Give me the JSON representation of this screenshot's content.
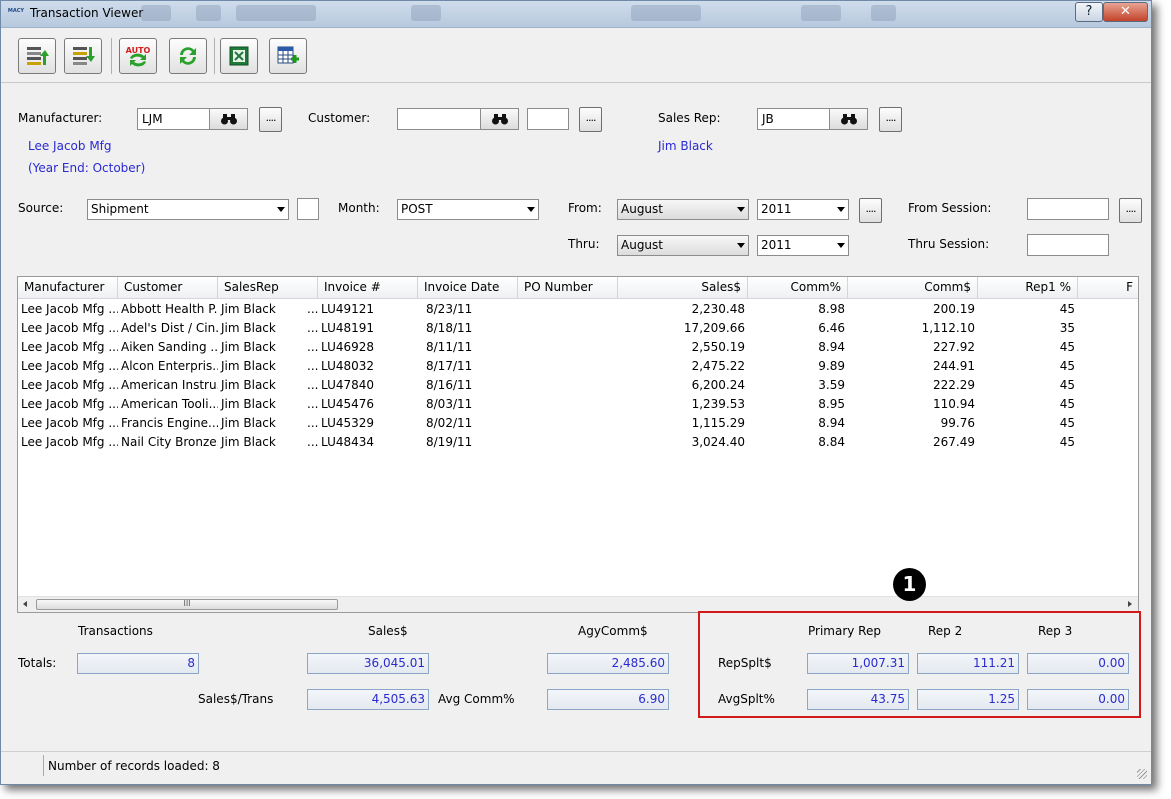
{
  "window": {
    "title": "Transaction Viewer",
    "help_label": "?",
    "close_label": "✕",
    "app_icon_text": "MACY"
  },
  "toolbar": {
    "buttons": [
      {
        "name": "import-up-button",
        "icon": "stack-up-arrow-icon"
      },
      {
        "name": "import-down-button",
        "icon": "stack-down-arrow-icon"
      },
      {
        "name": "auto-refresh-button",
        "icon": "auto-refresh-icon",
        "text": "AUTO"
      },
      {
        "name": "refresh-button",
        "icon": "refresh-icon"
      },
      {
        "name": "excel-export-button",
        "icon": "excel-icon"
      },
      {
        "name": "add-grid-button",
        "icon": "grid-add-icon"
      }
    ]
  },
  "filters": {
    "manufacturer_label": "Manufacturer:",
    "manufacturer_value": "LJM",
    "manufacturer_name": "Lee Jacob Mfg",
    "manufacturer_yearend": "(Year End: October)",
    "customer_label": "Customer:",
    "customer_value": "",
    "customer_value2": "",
    "salesrep_label": "Sales Rep:",
    "salesrep_value": "JB",
    "salesrep_name": "Jim Black",
    "source_label": "Source:",
    "source_value": "Shipment",
    "month_label": "Month:",
    "month_value": "POST",
    "from_label": "From:",
    "from_month": "August",
    "from_year": "2011",
    "thru_label": "Thru:",
    "thru_month": "August",
    "thru_year": "2011",
    "from_session_label": "From Session:",
    "from_session_value": "",
    "thru_session_label": "Thru Session:",
    "thru_session_value": "",
    "ellipsis": "...."
  },
  "grid": {
    "columns": [
      "Manufacturer",
      "Customer",
      "SalesRep",
      "Invoice #",
      "Invoice Date",
      "PO Number",
      "Sales$",
      "Comm%",
      "Comm$",
      "Rep1 %",
      "F"
    ],
    "rows": [
      {
        "manufacturer": "Lee Jacob Mfg ...",
        "customer": "Abbott Health P...",
        "salesrep": "Jim Black",
        "dots": "...",
        "invoice": "LU49121",
        "date": "8/23/11",
        "po": "",
        "sales": "2,230.48",
        "comm_pct": "8.98",
        "comm": "200.19",
        "rep1": "45"
      },
      {
        "manufacturer": "Lee Jacob Mfg ...",
        "customer": "Adel's Dist / Cin...",
        "salesrep": "Jim Black",
        "dots": "...",
        "invoice": "LU48191",
        "date": "8/18/11",
        "po": "",
        "sales": "17,209.66",
        "comm_pct": "6.46",
        "comm": "1,112.10",
        "rep1": "35"
      },
      {
        "manufacturer": "Lee Jacob Mfg ...",
        "customer": "Aiken Sanding ...",
        "salesrep": "Jim Black",
        "dots": "...",
        "invoice": "LU46928",
        "date": "8/11/11",
        "po": "",
        "sales": "2,550.19",
        "comm_pct": "8.94",
        "comm": "227.92",
        "rep1": "45"
      },
      {
        "manufacturer": "Lee Jacob Mfg ...",
        "customer": "Alcon Enterpris...",
        "salesrep": "Jim Black",
        "dots": "...",
        "invoice": "LU48032",
        "date": "8/17/11",
        "po": "",
        "sales": "2,475.22",
        "comm_pct": "9.89",
        "comm": "244.91",
        "rep1": "45"
      },
      {
        "manufacturer": "Lee Jacob Mfg ...",
        "customer": "American Instru...",
        "salesrep": "Jim Black",
        "dots": "...",
        "invoice": "LU47840",
        "date": "8/16/11",
        "po": "",
        "sales": "6,200.24",
        "comm_pct": "3.59",
        "comm": "222.29",
        "rep1": "45"
      },
      {
        "manufacturer": "Lee Jacob Mfg ...",
        "customer": "American Tooli...",
        "salesrep": "Jim Black",
        "dots": "...",
        "invoice": "LU45476",
        "date": "8/03/11",
        "po": "",
        "sales": "1,239.53",
        "comm_pct": "8.95",
        "comm": "110.94",
        "rep1": "45"
      },
      {
        "manufacturer": "Lee Jacob Mfg ...",
        "customer": "Francis Engine...",
        "salesrep": "Jim Black",
        "dots": "...",
        "invoice": "LU45329",
        "date": "8/02/11",
        "po": "",
        "sales": "1,115.29",
        "comm_pct": "8.94",
        "comm": "99.76",
        "rep1": "45"
      },
      {
        "manufacturer": "Lee Jacob Mfg ...",
        "customer": "Nail City Bronze...",
        "salesrep": "Jim Black",
        "dots": "...",
        "invoice": "LU48434",
        "date": "8/19/11",
        "po": "",
        "sales": "3,024.40",
        "comm_pct": "8.84",
        "comm": "267.49",
        "rep1": "45"
      }
    ],
    "scroll_grip": "III"
  },
  "totals": {
    "transactions_header": "Transactions",
    "sales_header": "Sales$",
    "agycomm_header": "AgyComm$",
    "totals_label": "Totals:",
    "transactions": "8",
    "sales": "36,045.01",
    "agycomm": "2,485.60",
    "sales_per_trans_label": "Sales$/Trans",
    "sales_per_trans": "4,505.63",
    "avg_comm_label": "Avg Comm%",
    "avg_comm": "6.90"
  },
  "rep_split": {
    "primary_header": "Primary Rep",
    "rep2_header": "Rep 2",
    "rep3_header": "Rep 3",
    "repsplt_label": "RepSplt$",
    "repsplt_primary": "1,007.31",
    "repsplt_rep2": "111.21",
    "repsplt_rep3": "0.00",
    "avgsplt_label": "AvgSplt%",
    "avgsplt_primary": "43.75",
    "avgsplt_rep2": "1.25",
    "avgsplt_rep3": "0.00",
    "callout": "1"
  },
  "status": {
    "text": "Number of records loaded: 8"
  },
  "colors": {
    "accent_blue": "#2a2ad0",
    "highlight_red": "#d21a1a"
  }
}
